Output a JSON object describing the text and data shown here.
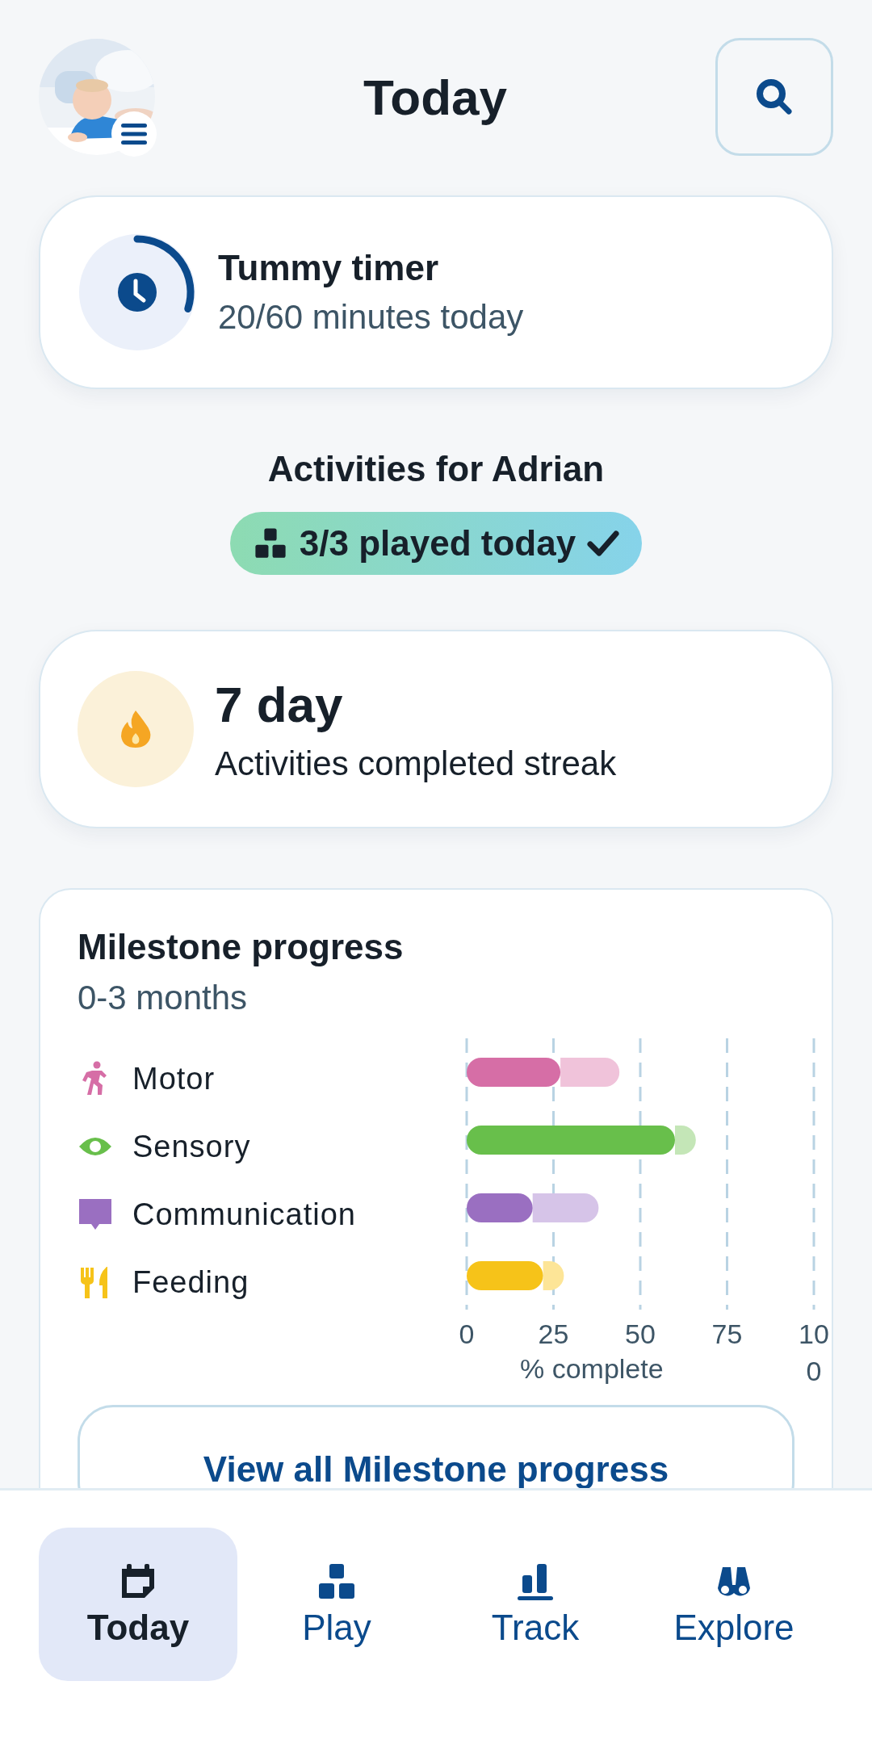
{
  "header": {
    "title": "Today"
  },
  "tummy_timer": {
    "title": "Tummy timer",
    "subtitle": "20/60 minutes today"
  },
  "activities": {
    "heading": "Activities for Adrian",
    "badge": "3/3 played today"
  },
  "streak": {
    "title": "7 day",
    "subtitle": "Activities completed streak"
  },
  "milestone": {
    "title": "Milestone progress",
    "subtitle": "0-3 months",
    "chart_data": {
      "type": "bar",
      "orientation": "horizontal",
      "xlabel": "% complete",
      "categories": [
        "Motor",
        "Sensory",
        "Communication",
        "Feeding"
      ],
      "series": [
        {
          "colors": [
            "#d66ea6",
            "#68bf4b",
            "#9a6fc1",
            "#f6c319"
          ],
          "values": [
            27,
            60,
            19,
            22
          ]
        },
        {
          "colors": [
            "#f0c3da",
            "#c4e6b7",
            "#d6c4e8",
            "#fde597"
          ],
          "values": [
            17,
            6,
            19,
            6
          ]
        }
      ],
      "stacked": true,
      "grid": true,
      "xlim": [
        0,
        100
      ],
      "xticks": [
        0,
        25,
        50,
        75,
        {
          "value": 100,
          "label": "100"
        }
      ]
    },
    "button": "View all Milestone progress"
  },
  "nav": [
    {
      "label": "Today",
      "selected": true
    },
    {
      "label": "Play",
      "selected": false
    },
    {
      "label": "Track",
      "selected": false
    },
    {
      "label": "Explore",
      "selected": false
    }
  ]
}
